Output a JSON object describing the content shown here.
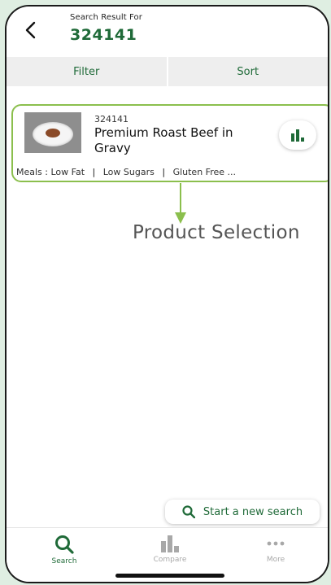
{
  "header": {
    "subtitle": "Search Result For",
    "query": "324141"
  },
  "filter_bar": {
    "filter_label": "Filter",
    "sort_label": "Sort"
  },
  "result": {
    "code": "324141",
    "name": "Premium Roast Beef in Gravy",
    "tags_prefix": "Meals :",
    "tags": [
      "Low Fat",
      "Low Sugars",
      "Gluten Free"
    ],
    "tags_more": "..."
  },
  "annotation": {
    "label": "Product Selection"
  },
  "new_search": {
    "label": "Start a new search",
    "icon": "search-icon"
  },
  "tabs": [
    {
      "label": "Search",
      "icon": "search-icon",
      "active": true
    },
    {
      "label": "Compare",
      "icon": "bar-chart-icon",
      "active": false
    },
    {
      "label": "More",
      "icon": "more-dots-icon",
      "active": false
    }
  ],
  "colors": {
    "brand_green": "#1f6a38",
    "highlight_border": "#8bbf4d",
    "inactive_gray": "#a8a8a8"
  }
}
